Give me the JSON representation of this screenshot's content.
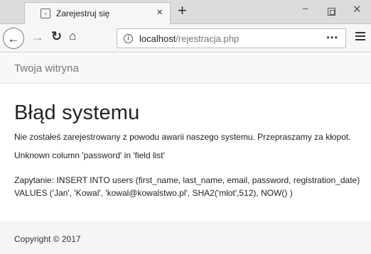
{
  "browser": {
    "tab": {
      "title": "Zarejestruj się",
      "close_glyph": "×",
      "favicon": "page-icon"
    },
    "new_tab_glyph": "+",
    "window_controls": {
      "minimize": "▭",
      "close": "✕"
    },
    "nav": {
      "back": "←",
      "forward": "→",
      "reload": "C",
      "home": "⌂"
    },
    "url": {
      "host": "localhost",
      "path": "/rejestracja.php",
      "info_glyph": "i",
      "more_glyph": "•••"
    }
  },
  "page": {
    "brand": "Twoja witryna",
    "heading": "Błąd systemu",
    "message": "Nie zostałeś zarejestrowany z powodu awarii naszego systemu. Przepraszamy za kłopot.",
    "error": "Unknown column 'password' in 'field list'",
    "query_line1": "Zapytanie: INSERT INTO users (first_name, last_name, email, password, registration_date)",
    "query_line2": "VALUES ('Jan', 'Kowal', 'kowal@kowalstwo.pl', SHA2('mlot',512), NOW() )",
    "footer": "Copyright © 2017"
  },
  "colors": {
    "chrome_bg": "#dcdcdc",
    "toolbar_bg": "#f6f6f6",
    "header_bg": "#f8f8f8",
    "footer_bg": "#f5f5f5",
    "brand_text": "#777777"
  }
}
